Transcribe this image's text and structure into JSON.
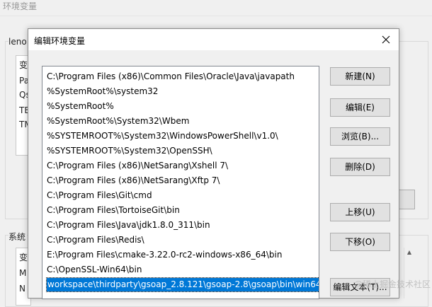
{
  "background": {
    "title": "环境变量",
    "user_group_label": "leno",
    "user_list_partial": [
      "变",
      "Pa",
      "Qs",
      "TE",
      "TM"
    ],
    "system_group_label": "系统",
    "system_list_partial": [
      "变",
      "M",
      "N"
    ]
  },
  "dialog": {
    "title": "编辑环境变量",
    "paths": [
      "C:\\Program Files (x86)\\Common Files\\Oracle\\Java\\javapath",
      "%SystemRoot%\\system32",
      "%SystemRoot%",
      "%SystemRoot%\\System32\\Wbem",
      "%SYSTEMROOT%\\System32\\WindowsPowerShell\\v1.0\\",
      "%SYSTEMROOT%\\System32\\OpenSSH\\",
      "C:\\Program Files (x86)\\NetSarang\\Xshell 7\\",
      "C:\\Program Files (x86)\\NetSarang\\Xftp 7\\",
      "C:\\Program Files\\Git\\cmd",
      "C:\\Program Files\\TortoiseGit\\bin",
      "C:\\Program Files\\Java\\jdk1.8.0_311\\bin",
      "C:\\Program Files\\Redis\\",
      "E:\\Program Files\\cmake-3.22.0-rc2-windows-x86_64\\bin",
      "C:\\OpenSSL-Win64\\bin",
      "workspace\\thirdparty\\gsoap_2.8.121\\gsoap-2.8\\gsoap\\bin\\win64"
    ],
    "selected_index": 14,
    "buttons": {
      "new": "新建(N)",
      "edit": "编辑(E)",
      "browse": "浏览(B)...",
      "delete": "删除(D)",
      "move_up": "上移(U)",
      "move_down": "下移(O)",
      "edit_text": "编辑文本(T)..."
    }
  },
  "watermark": "@稀土掘金技术社区",
  "colors": {
    "selection": "#0078d7",
    "dialog_bg": "#f0f0f0"
  }
}
